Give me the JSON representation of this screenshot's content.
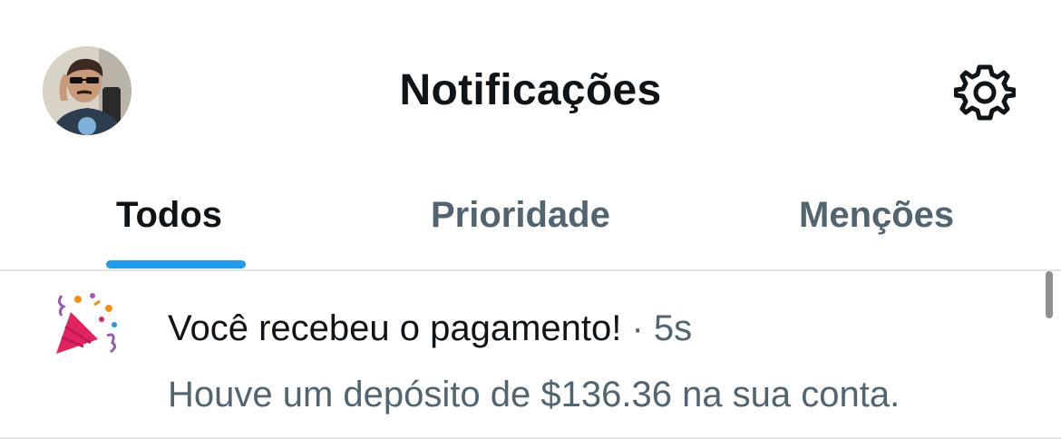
{
  "header": {
    "title": "Notificações",
    "avatar_icon": "user-avatar",
    "settings_icon": "gear-icon"
  },
  "tabs": [
    {
      "label": "Todos",
      "active": true
    },
    {
      "label": "Prioridade",
      "active": false
    },
    {
      "label": "Menções",
      "active": false
    }
  ],
  "notification": {
    "icon": "party-popper-icon",
    "title": "Você recebeu o pagamento!",
    "separator": " · ",
    "time": "5s",
    "body": "Houve um depósito de $136.36 na sua conta."
  },
  "colors": {
    "accent": "#1d9bf0",
    "text_primary": "#0f1419",
    "text_secondary": "#536471"
  }
}
